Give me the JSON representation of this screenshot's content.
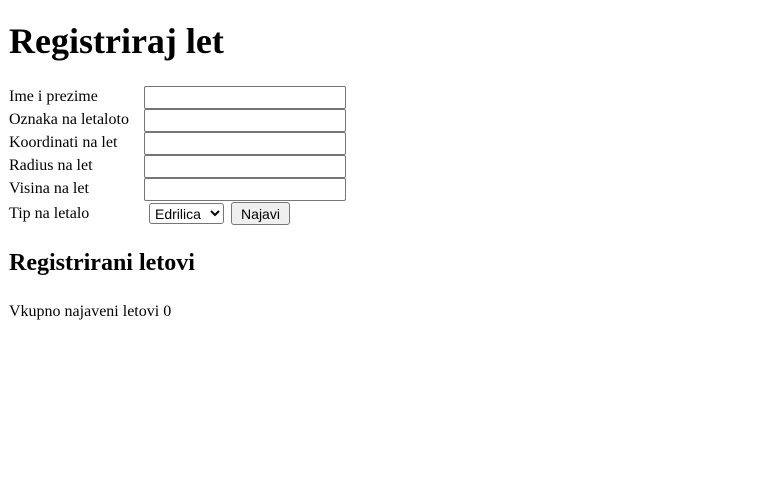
{
  "page": {
    "title": "Registriraj let"
  },
  "form": {
    "fields": [
      {
        "label": "Ime i prezime",
        "value": ""
      },
      {
        "label": "Oznaka na letaloto",
        "value": ""
      },
      {
        "label": "Koordinati na let",
        "value": ""
      },
      {
        "label": "Radius na let",
        "value": ""
      },
      {
        "label": "Visina na let",
        "value": ""
      }
    ],
    "aircraft_type": {
      "label": "Tip na letalo",
      "selected": "Edrilica",
      "options": [
        "Edrilica"
      ]
    },
    "submit_label": "Najavi"
  },
  "registered": {
    "heading": "Registrirani letovi",
    "summary_label": "Vkupno najaveni letovi",
    "count": "0"
  }
}
